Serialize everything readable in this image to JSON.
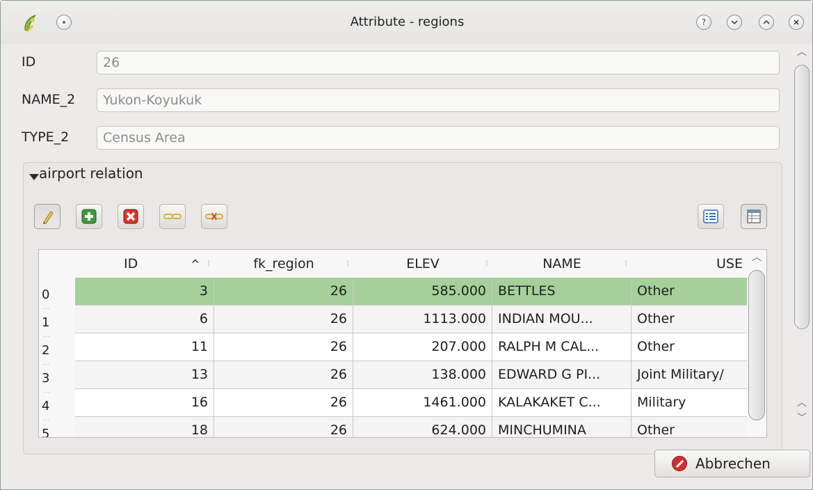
{
  "window": {
    "title": "Attribute - regions"
  },
  "form": {
    "fields": [
      {
        "label": "ID",
        "value": "26"
      },
      {
        "label": "NAME_2",
        "value": "Yukon-Koyukuk"
      },
      {
        "label": "TYPE_2",
        "value": "Census Area"
      }
    ]
  },
  "relation": {
    "title": "airport relation",
    "toolbar": [
      {
        "icon": "pencil-edit-icon"
      },
      {
        "icon": "add-feature-icon"
      },
      {
        "icon": "delete-feature-icon"
      },
      {
        "icon": "link-feature-icon"
      },
      {
        "icon": "unlink-feature-icon"
      },
      {
        "icon": "form-view-icon"
      },
      {
        "icon": "table-view-icon"
      }
    ],
    "table": {
      "headers": [
        "ID",
        "fk_region",
        "ELEV",
        "NAME",
        "USE"
      ],
      "sort_indicator": "^",
      "rows": [
        {
          "num": "0",
          "id": "3",
          "fk_region": "26",
          "elev": "585.000",
          "name": "BETTLES",
          "use": "Other"
        },
        {
          "num": "1",
          "id": "6",
          "fk_region": "26",
          "elev": "1113.000",
          "name": "INDIAN MOU...",
          "use": "Other"
        },
        {
          "num": "2",
          "id": "11",
          "fk_region": "26",
          "elev": "207.000",
          "name": "RALPH M CAL...",
          "use": "Other"
        },
        {
          "num": "3",
          "id": "13",
          "fk_region": "26",
          "elev": "138.000",
          "name": "EDWARD G PI...",
          "use": "Joint Military/"
        },
        {
          "num": "4",
          "id": "16",
          "fk_region": "26",
          "elev": "1461.000",
          "name": "KALAKAKET C...",
          "use": "Military"
        },
        {
          "num": "5",
          "id": "18",
          "fk_region": "26",
          "elev": "624.000",
          "name": "MINCHUMINA",
          "use": "Other"
        }
      ],
      "selected_row": 0
    }
  },
  "buttons": {
    "cancel_label": "Abbrechen"
  },
  "colors": {
    "selected_row": "#a6d09b",
    "cancel_icon": "#d22f2f"
  }
}
